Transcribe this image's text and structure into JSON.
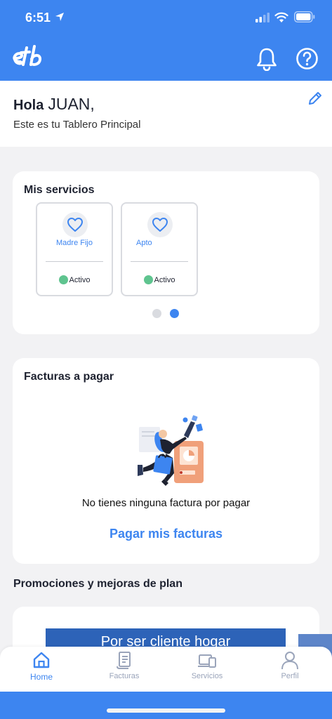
{
  "status_bar": {
    "time": "6:51"
  },
  "header": {
    "logo_icon": "etb-logo",
    "notification_icon": "bell-icon",
    "help_icon": "help-circle-icon",
    "brand_color": "#3d85f0"
  },
  "greeting": {
    "hello": "Hola",
    "name": "JUAN,",
    "subtitle": "Este es tu Tablero Principal",
    "edit_icon": "pencil-icon"
  },
  "services": {
    "title": "Mis servicios",
    "items": [
      {
        "name": "Madre Fijo",
        "status": "Activo",
        "icon": "heart-icon"
      },
      {
        "name": "Apto",
        "status": "Activo",
        "icon": "heart-icon"
      }
    ],
    "status_color": "#5fc48f",
    "pager": {
      "pages": 2,
      "active_page": 2
    }
  },
  "bills": {
    "title": "Facturas a pagar",
    "empty_message": "No tienes ninguna factura por pagar",
    "pay_link": "Pagar mis facturas"
  },
  "promotions": {
    "title": "Promociones y mejoras de plan",
    "banner_text": "Por ser cliente hogar"
  },
  "tab_bar": {
    "tabs": [
      {
        "label": "Home",
        "icon": "home-icon",
        "active": true
      },
      {
        "label": "Facturas",
        "icon": "receipt-icon",
        "active": false
      },
      {
        "label": "Servicios",
        "icon": "devices-icon",
        "active": false
      },
      {
        "label": "Perfil",
        "icon": "user-icon",
        "active": false
      }
    ]
  }
}
